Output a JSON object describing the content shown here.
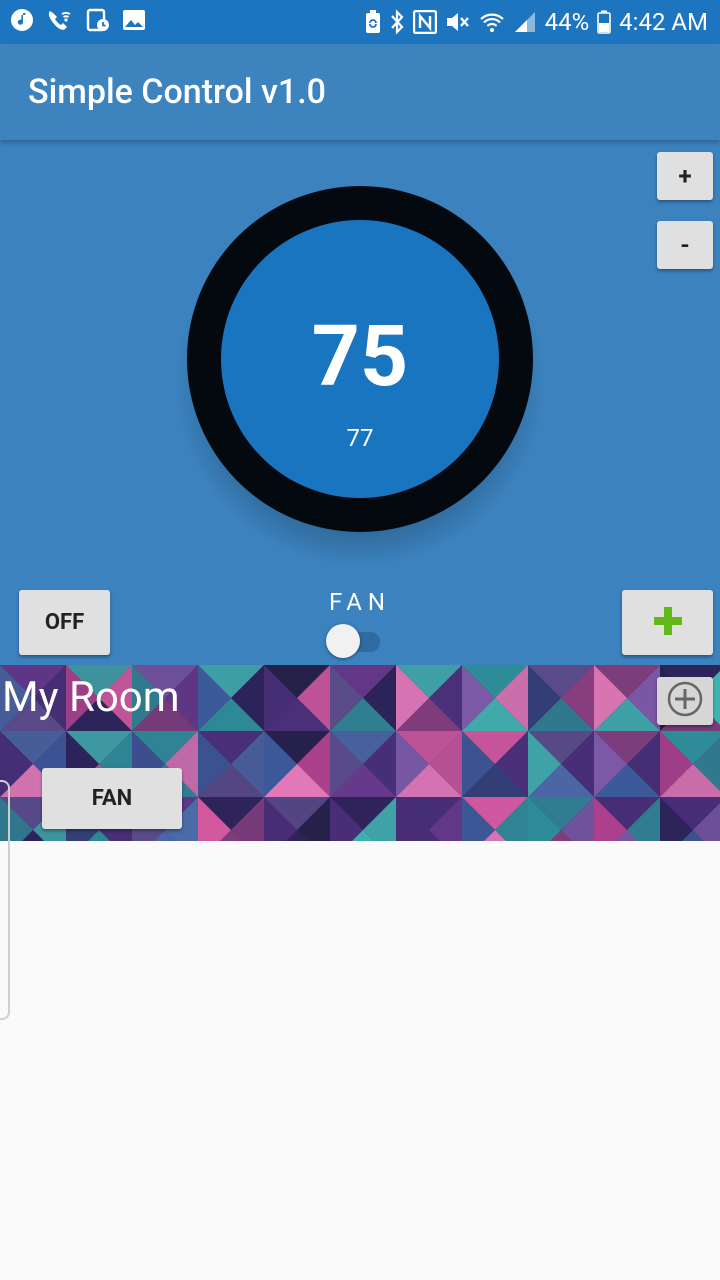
{
  "status_bar": {
    "battery": "44%",
    "time": "4:42 AM",
    "icons": [
      "music-icon",
      "wifi-call-icon",
      "clock-icon",
      "image-icon",
      "battery-saver-icon",
      "bluetooth-icon",
      "nfc-icon",
      "mute-icon",
      "wifi-icon",
      "signal-icon",
      "battery-icon"
    ]
  },
  "app_bar": {
    "title": "Simple Control v1.0"
  },
  "thermostat": {
    "setpoint": "75",
    "current_temp": "77",
    "increase_label": "+",
    "decrease_label": "-",
    "mode_label": "OFF",
    "fan_label": "FAN",
    "fan_on": false,
    "add_icon": "plus-icon"
  },
  "room": {
    "title": "My Room",
    "fan_button_label": "FAN",
    "add_icon": "add-circle-icon"
  },
  "colors": {
    "status_bar": "#1d74bf",
    "app_bar": "#3d84bf",
    "panel": "#3b82be",
    "dial_face": "#1a75c1",
    "dial_ring": "#03090e",
    "add_green": "#63b81a",
    "button_gray": "#e0e0e0"
  }
}
